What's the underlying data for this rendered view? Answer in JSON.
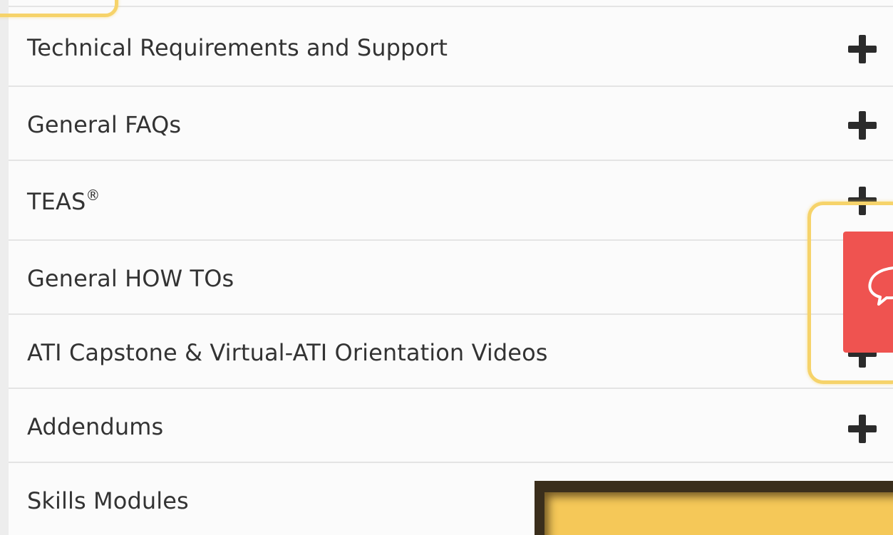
{
  "accordion": {
    "items": [
      {
        "label": "Technical Requirements and Support"
      },
      {
        "label": "General FAQs"
      },
      {
        "label": "TEAS",
        "superscript": "®"
      },
      {
        "label": "General HOW TOs"
      },
      {
        "label": "ATI Capstone & Virtual-ATI Orientation Videos"
      },
      {
        "label": "Addendums"
      },
      {
        "label": "Skills Modules"
      }
    ],
    "expand_icon": "plus-icon"
  },
  "chat": {
    "icon": "speech-bubble-icon",
    "accent_color": "#ef5350",
    "focus_color": "#f6d36a"
  },
  "colors": {
    "text": "#333333",
    "divider": "#e4e4e4",
    "background": "#fbfbfb"
  }
}
